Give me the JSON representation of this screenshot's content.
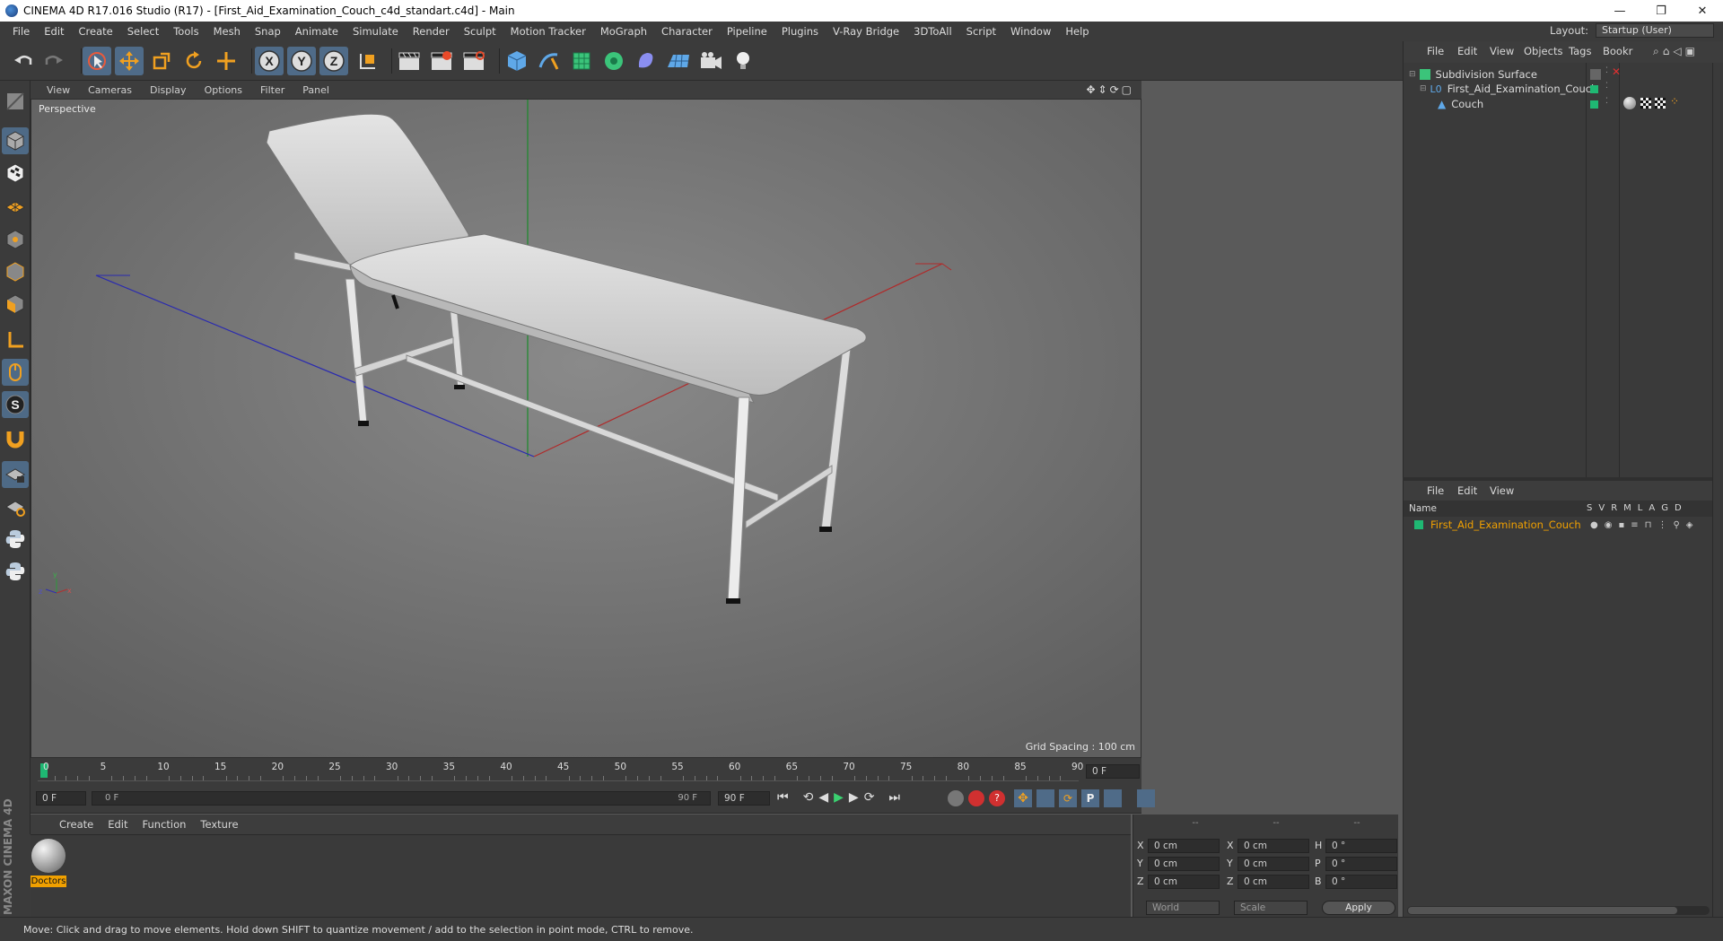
{
  "titlebar": {
    "title": "CINEMA 4D R17.016 Studio (R17) - [First_Aid_Examination_Couch_c4d_standart.c4d] - Main",
    "buttons": [
      "—",
      "❐",
      "✕"
    ]
  },
  "menubar": {
    "items": [
      "File",
      "Edit",
      "Create",
      "Select",
      "Tools",
      "Mesh",
      "Snap",
      "Animate",
      "Simulate",
      "Render",
      "Sculpt",
      "Motion Tracker",
      "MoGraph",
      "Character",
      "Pipeline",
      "Plugins",
      "V-Ray Bridge",
      "3DToAll",
      "Script",
      "Window",
      "Help"
    ],
    "layout_label": "Layout:",
    "layout_value": "Startup (User)"
  },
  "viewport": {
    "menu": [
      "View",
      "Cameras",
      "Display",
      "Options",
      "Filter",
      "Panel"
    ],
    "label": "Perspective",
    "grid_spacing": "Grid Spacing : 100 cm"
  },
  "timeline": {
    "ticks": [
      "0",
      "5",
      "10",
      "15",
      "20",
      "25",
      "30",
      "35",
      "40",
      "45",
      "50",
      "55",
      "60",
      "65",
      "70",
      "75",
      "80",
      "85",
      "90"
    ],
    "current_frame_right": "0 F",
    "start_field": "0 F",
    "range_start": "0 F",
    "range_end": "90 F",
    "end_field": "90 F"
  },
  "material_manager": {
    "menu": [
      "Create",
      "Edit",
      "Function",
      "Texture"
    ],
    "material_name": "Doctors"
  },
  "coordinates": {
    "headers": [
      "--",
      "--",
      "--"
    ],
    "rows": [
      {
        "a": "X",
        "av": "0 cm",
        "b": "X",
        "bv": "0 cm",
        "c": "H",
        "cv": "0 °"
      },
      {
        "a": "Y",
        "av": "0 cm",
        "b": "Y",
        "bv": "0 cm",
        "c": "P",
        "cv": "0 °"
      },
      {
        "a": "Z",
        "av": "0 cm",
        "b": "Z",
        "bv": "0 cm",
        "c": "B",
        "cv": "0 °"
      }
    ],
    "world": "World",
    "scale": "Scale",
    "apply": "Apply"
  },
  "object_manager": {
    "menu": [
      "File",
      "Edit",
      "View",
      "Objects",
      "Tags",
      "Bookr"
    ],
    "objects": [
      "Subdivision Surface",
      "First_Aid_Examination_Couch",
      "Couch"
    ]
  },
  "attribute_manager": {
    "menu": [
      "File",
      "Edit",
      "View"
    ],
    "columns": [
      "Name",
      "S",
      "V",
      "R",
      "M",
      "L",
      "A",
      "G",
      "D"
    ],
    "layer_name": "First_Aid_Examination_Couch"
  },
  "status": {
    "text": "Move: Click and drag to move elements. Hold down SHIFT to quantize movement / add to the selection in point mode, CTRL to remove."
  },
  "maxon_logo": "MAXON CINEMA 4D",
  "colors": {
    "accent": "#4f6b88",
    "layer_green": "#1fb873",
    "layer_text": "#f0a000",
    "material_label_bg": "#f0a000"
  }
}
